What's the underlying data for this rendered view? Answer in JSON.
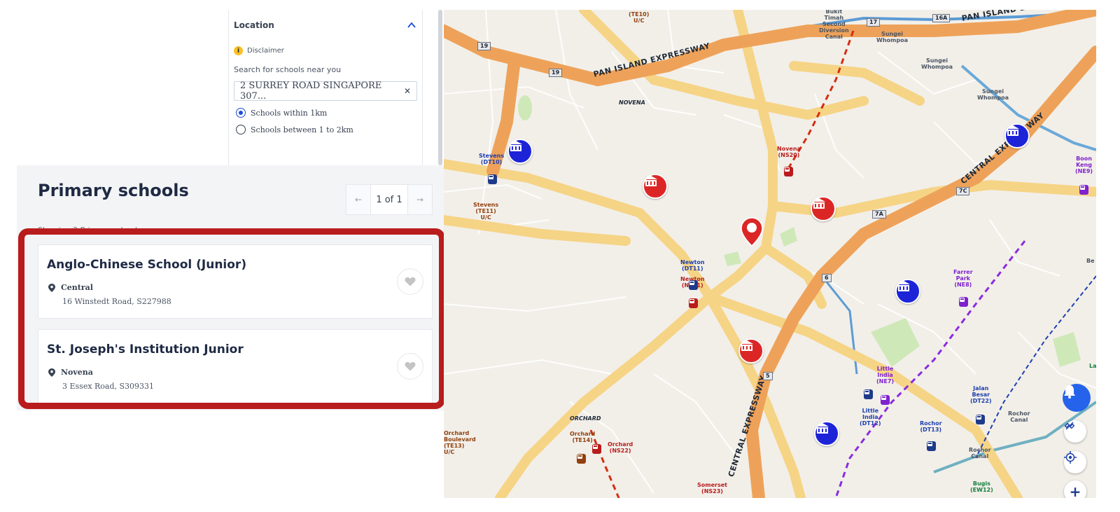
{
  "filter": {
    "title": "Location",
    "disclaimer": "Disclaimer",
    "search_label": "Search for schools near you",
    "address_value": "2 SURREY ROAD SINGAPORE 307...",
    "radius_options": [
      {
        "label": "Schools within 1km",
        "selected": true
      },
      {
        "label": "Schools between 1 to 2km",
        "selected": false
      }
    ]
  },
  "results": {
    "title": "Primary schools",
    "pagination": {
      "prev": "←",
      "current": "1 of 1",
      "next": "→"
    },
    "showing": "Showing 2 Primary schools",
    "schools": [
      {
        "name": "Anglo-Chinese School (Junior)",
        "region": "Central",
        "address": "16 Winstedt Road, S227988"
      },
      {
        "name": "St. Joseph's Institution Junior",
        "region": "Novena",
        "address": "3 Essex Road, S309331"
      }
    ]
  },
  "map": {
    "colors": {
      "land": "#f2efe9",
      "road": "#f6d486",
      "expressway": "#eea259",
      "mrt_red": "#d42e12",
      "mrt_purple": "#8a2be2",
      "canal": "#4a90d9"
    },
    "road_labels": {
      "pie_left": "PAN ISLAND EXPRESSWAY",
      "pie_right": "PAN ISLAND EXPRESSWAY",
      "cte_upper": "CENTRAL EXPRESSWAY",
      "cte_lower": "CENTRAL EXPRESSWAY"
    },
    "area_labels": {
      "novena": "NOVENA",
      "orchard": "ORCHARD"
    },
    "road_shields": [
      "19",
      "19",
      "17",
      "16A",
      "7C",
      "7A",
      "6",
      "5"
    ],
    "station_labels": {
      "te10": "(TE10)\nU/C",
      "bukit_timah": "Bukit\nTimah\nSecond\nDiversion\nCanal",
      "sungei_whompoa_a": "Sungei\nWhompoa",
      "sungei_whompoa_b": "Sungei\nWhompoa",
      "sungei_whompoa_c": "Sungei\nWhompoa",
      "stevens_dt10": "Stevens\n(DT10)",
      "stevens_te11": "Stevens\n(TE11)\nU/C",
      "novena_ns20": "Novena\n(NS20)",
      "boon_keng": "Boon\nKeng\n(NE9)",
      "newton_dt11": "Newton\n(DT11)",
      "newton_ns21": "Newton\n(NS21)",
      "farrer_park": "Farrer\nPark\n(NE8)",
      "little_india_ne7": "Little\nIndia\n(NE7)",
      "little_india_dt12": "Little\nIndia\n(DT12)",
      "jalan_besar": "Jalan\nBesar\n(DT22)",
      "rochor_dt13": "Rochor\n(DT13)",
      "rochor_canal_a": "Rochor\nCanal",
      "rochor_canal_b": "Rochor\nCanal",
      "orchard_te14": "Orchard\n(TE14)",
      "orchard_ns22": "Orchard\n(NS22)",
      "orchard_blvd": "Orchard\nBoulevard\n(TE13)\nU/C",
      "somerset": "Somerset\n(NS23)",
      "bugis": "Bugis\n(EW12)",
      "edge_be": "Be",
      "edge_la": "La"
    },
    "controls": {
      "zoom_in": "+"
    }
  }
}
